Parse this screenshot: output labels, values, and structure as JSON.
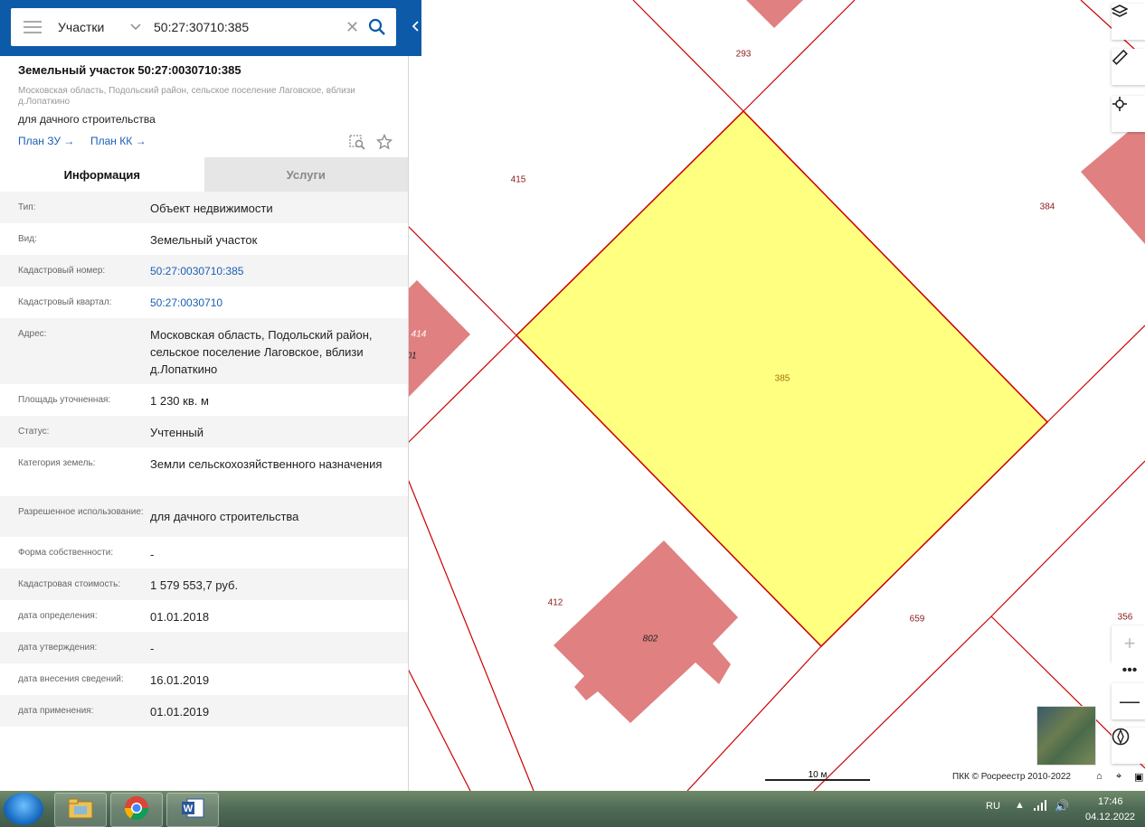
{
  "search": {
    "type": "Участки",
    "value": "50:27:30710:385"
  },
  "object": {
    "title": "Земельный участок 50:27:0030710:385",
    "address": "Московская область, Подольский район, сельское поселение Лаговское, вблизи д.Лопаткино",
    "use": "для дачного строительства",
    "plan_zu": "План ЗУ →",
    "plan_kk": "План КК →"
  },
  "tabs": {
    "info": "Информация",
    "services": "Услуги"
  },
  "info_rows": [
    {
      "label": "Тип:",
      "value": "Объект недвижимости"
    },
    {
      "label": "Вид:",
      "value": "Земельный участок"
    },
    {
      "label": "Кадастровый номер:",
      "value": "50:27:0030710:385"
    },
    {
      "label": "Кадастровый квартал:",
      "value": "50:27:0030710"
    },
    {
      "label": "Адрес:",
      "value": "Московская область, Подольский район, сельское поселение Лаговское, вблизи д.Лопаткино"
    },
    {
      "label": "Площадь уточненная:",
      "value": "1 230 кв. м"
    },
    {
      "label": "Статус:",
      "value": "Учтенный"
    },
    {
      "label": "Категория земель:",
      "value": "Земли сельскохозяйственного назначения"
    },
    {
      "label": "Разрешенное использование:",
      "value": "для дачного строительства"
    },
    {
      "label": "Форма собственности:",
      "value": "-"
    },
    {
      "label": "Кадастровая стоимость:",
      "value": "1 579 553,7 руб."
    },
    {
      "label": "дата определения:",
      "value": "01.01.2018"
    },
    {
      "label": "дата утверждения:",
      "value": "-"
    },
    {
      "label": "дата внесения сведений:",
      "value": "16.01.2019"
    },
    {
      "label": "дата применения:",
      "value": "01.01.2019"
    }
  ],
  "map_labels": {
    "p293": "293",
    "p415": "415",
    "p384": "384",
    "p414": "414",
    "p01": "01",
    "p385": "385",
    "p412": "412",
    "p802": "802",
    "p659": "659",
    "p356": "356"
  },
  "map": {
    "scale": "10 м",
    "attribution": "ПКК © Росреестр 2010-2022",
    "colors": {
      "selected_fill": "#ffff80",
      "building_fill": "#e08080",
      "boundary": "#cc0000"
    }
  },
  "taskbar": {
    "lang": "RU",
    "time": "17:46",
    "date": "04.12.2022"
  }
}
